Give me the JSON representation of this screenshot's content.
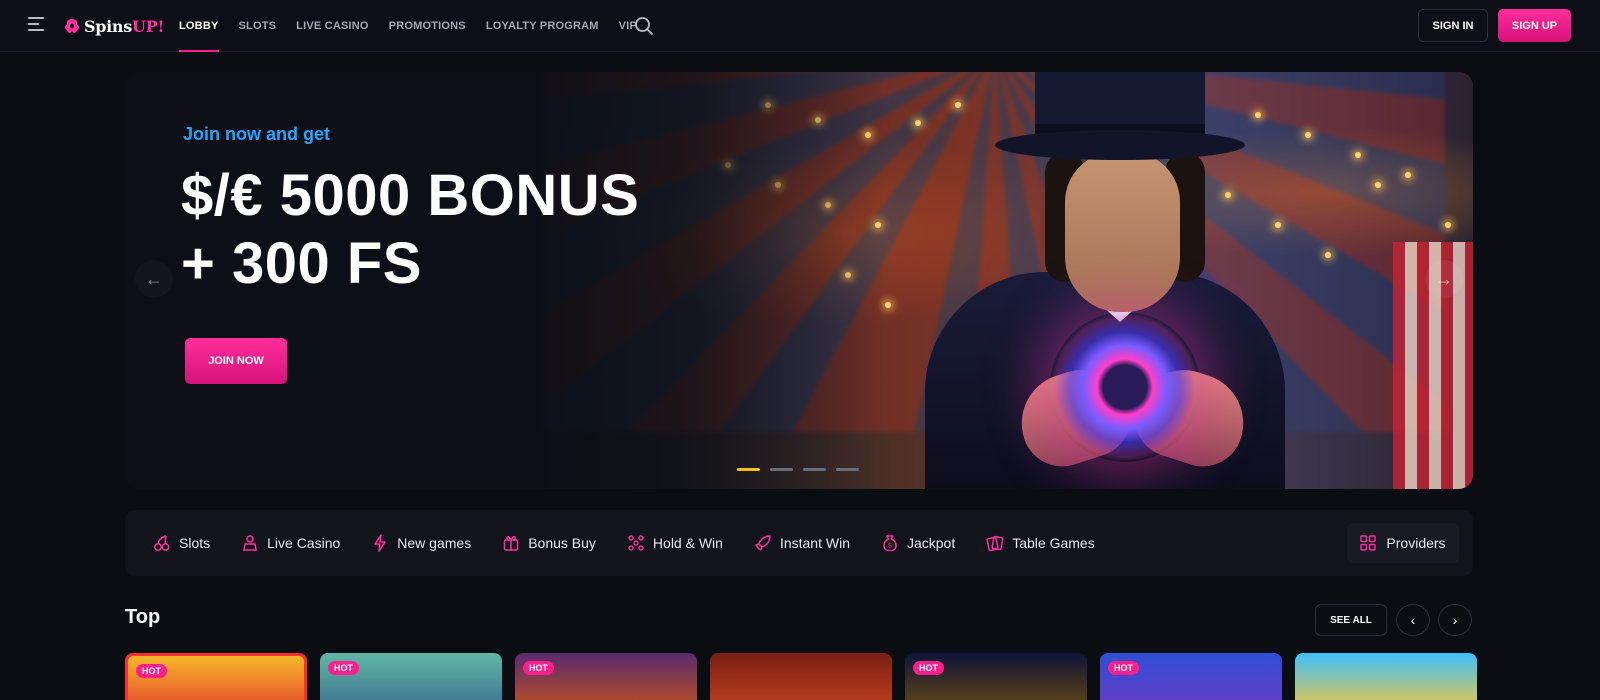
{
  "header": {
    "logo_text": "Spins",
    "logo_accent": "UP!",
    "nav": [
      "LOBBY",
      "SLOTS",
      "LIVE CASINO",
      "PROMOTIONS",
      "LOYALTY PROGRAM",
      "VIP"
    ],
    "signin_label": "SIGN IN",
    "signup_label": "SIGN UP"
  },
  "hero": {
    "subtitle": "Join now and get",
    "title_line1": "$/€ 5000 BONUS",
    "title_line2": "+ 300 FS",
    "cta_label": "JOIN NOW",
    "slides": 4,
    "active_slide": 1
  },
  "categories": {
    "items": [
      {
        "label": "Slots",
        "icon": "cherry-icon"
      },
      {
        "label": "Live Casino",
        "icon": "dealer-icon"
      },
      {
        "label": "New games",
        "icon": "lightning-icon"
      },
      {
        "label": "Bonus Buy",
        "icon": "gift-icon"
      },
      {
        "label": "Hold & Win",
        "icon": "dots-grid-icon"
      },
      {
        "label": "Instant Win",
        "icon": "rocket-icon"
      },
      {
        "label": "Jackpot",
        "icon": "money-bag-icon"
      },
      {
        "label": "Table Games",
        "icon": "cards-icon"
      }
    ],
    "providers_label": "Providers"
  },
  "top_section": {
    "title": "Top",
    "see_all_label": "SEE ALL",
    "games": [
      {
        "badge": "HOT"
      },
      {
        "badge": "HOT"
      },
      {
        "badge": "HOT"
      },
      {
        "badge": ""
      },
      {
        "badge": "HOT"
      },
      {
        "badge": "HOT"
      },
      {
        "badge": ""
      }
    ]
  },
  "colors": {
    "accent_pink": "#ff1f8c",
    "accent_blue": "#22a7ff",
    "slide_active": "#ffc400",
    "background": "#0a0d12"
  }
}
